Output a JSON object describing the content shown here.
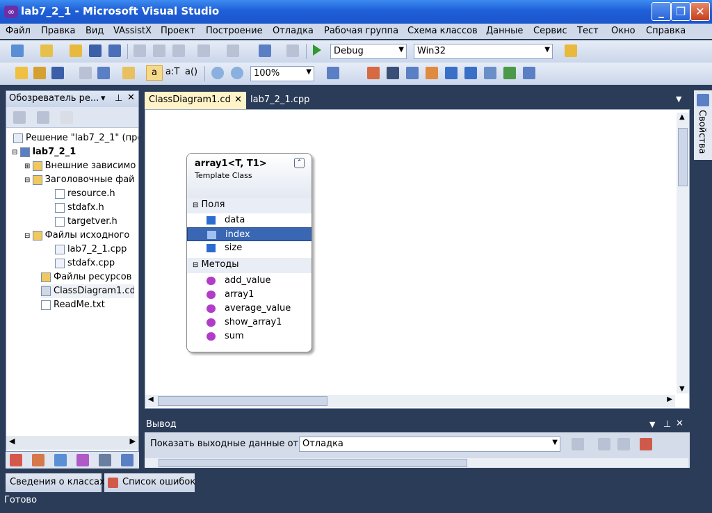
{
  "window": {
    "title": "lab7_2_1 - Microsoft Visual Studio",
    "logo": "∞"
  },
  "menu": [
    "Файл",
    "Правка",
    "Вид",
    "VAssistX",
    "Проект",
    "Построение",
    "Отладка",
    "Рабочая группа",
    "Схема классов",
    "Данные",
    "Сервис",
    "Тест",
    "Окно",
    "Справка"
  ],
  "toolbar": {
    "config": "Debug",
    "platform": "Win32",
    "zoom": "100%",
    "text_a": "a",
    "text_at": "a:T",
    "text_a0": "a()"
  },
  "solution_explorer": {
    "title": "Обозреватель ре...",
    "items": [
      {
        "label": "Решение \"lab7_2_1\" (про",
        "indent": 0,
        "icon": "solution-icon",
        "bold": false
      },
      {
        "label": "lab7_2_1",
        "indent": 1,
        "icon": "project-icon",
        "bold": true
      },
      {
        "label": "Внешние зависимо",
        "indent": 2,
        "icon": "folder-icon",
        "bold": false
      },
      {
        "label": "Заголовочные фай",
        "indent": 2,
        "icon": "folder-icon",
        "bold": false
      },
      {
        "label": "resource.h",
        "indent": 3,
        "icon": "header-file-icon",
        "bold": false
      },
      {
        "label": "stdafx.h",
        "indent": 3,
        "icon": "header-file-icon",
        "bold": false
      },
      {
        "label": "targetver.h",
        "indent": 3,
        "icon": "header-file-icon",
        "bold": false
      },
      {
        "label": "Файлы исходного",
        "indent": 2,
        "icon": "folder-icon",
        "bold": false
      },
      {
        "label": "lab7_2_1.cpp",
        "indent": 3,
        "icon": "cpp-file-icon",
        "bold": false
      },
      {
        "label": "stdafx.cpp",
        "indent": 3,
        "icon": "cpp-file-icon",
        "bold": false
      },
      {
        "label": "Файлы ресурсов",
        "indent": 2,
        "icon": "folder-icon",
        "bold": false
      },
      {
        "label": "ClassDiagram1.cd",
        "indent": 2,
        "icon": "class-diagram-icon",
        "bold": false
      },
      {
        "label": "ReadMe.txt",
        "indent": 2,
        "icon": "text-file-icon",
        "bold": false
      }
    ]
  },
  "tabs": [
    {
      "label": "ClassDiagram1.cd",
      "active": true
    },
    {
      "label": "lab7_2_1.cpp",
      "active": false
    }
  ],
  "class_shape": {
    "name": "array1<T, T1>",
    "kind": "Template Class",
    "sections": [
      {
        "title": "Поля",
        "members": [
          {
            "name": "data",
            "selected": false
          },
          {
            "name": "index",
            "selected": true
          },
          {
            "name": "size",
            "selected": false
          }
        ]
      },
      {
        "title": "Методы",
        "members": [
          {
            "name": "add_value",
            "selected": false
          },
          {
            "name": "array1",
            "selected": false
          },
          {
            "name": "average_value",
            "selected": false
          },
          {
            "name": "show_array1",
            "selected": false
          },
          {
            "name": "sum",
            "selected": false
          }
        ]
      }
    ]
  },
  "output": {
    "title": "Вывод",
    "show_label": "Показать выходные данные от:",
    "source": "Отладка"
  },
  "bottom_tabs": [
    "Сведения о классах",
    "Список ошибок"
  ],
  "properties_tab": "Свойства",
  "status": "Готово",
  "colors": {
    "selection": "#3a67b4",
    "titlebar": "#1f5fd8",
    "field_icon": "#2a6ccf",
    "method_icon": "#b23cc8"
  }
}
